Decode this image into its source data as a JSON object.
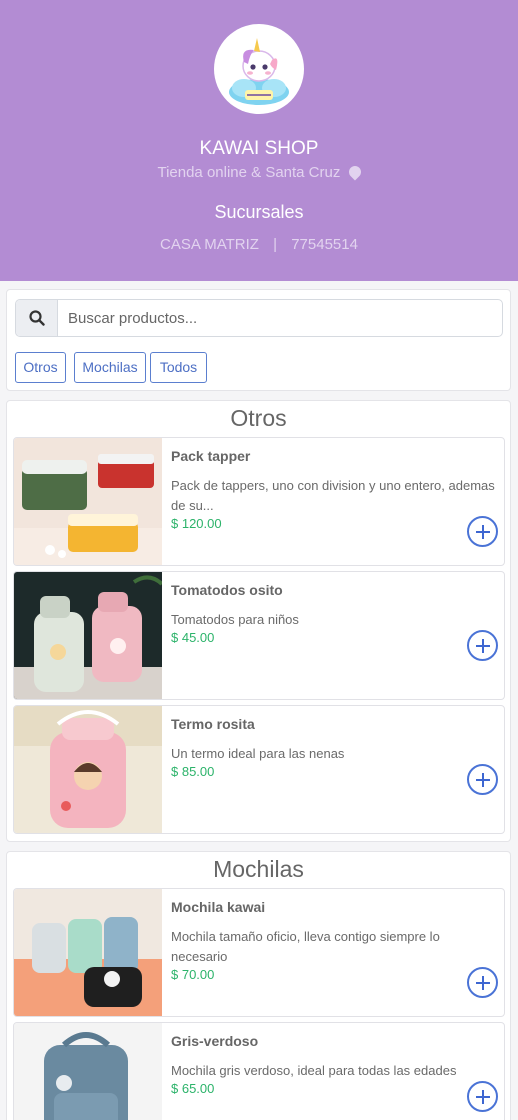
{
  "header": {
    "logo_icon": "unicorn-cloud-logo",
    "logo_text": "KAWAII SHOP",
    "shop_name": "KAWAI SHOP",
    "tagline": "Tienda online & Santa Cruz",
    "branches_title": "Sucursales",
    "branch_name": "CASA MATRIZ",
    "branch_separator": "|",
    "branch_phone": "77545514"
  },
  "search": {
    "icon": "search-icon",
    "placeholder": "Buscar productos..."
  },
  "filters": [
    "Otros",
    "Mochilas",
    "Todos"
  ],
  "sections": [
    {
      "title": "Otros",
      "products": [
        {
          "name": "Pack tapper",
          "description": "Pack de tappers, uno con division y uno entero, ademas de su...",
          "price": "$ 120.00"
        },
        {
          "name": "Tomatodos osito",
          "description": "Tomatodos para niños",
          "price": "$ 45.00"
        },
        {
          "name": "Termo rosita",
          "description": "Un termo ideal para las nenas",
          "price": "$ 85.00"
        }
      ]
    },
    {
      "title": "Mochilas",
      "products": [
        {
          "name": "Mochila kawai",
          "description": "Mochila tamaño oficio, lleva contigo siempre lo necesario",
          "price": "$ 70.00"
        },
        {
          "name": "Gris-verdoso",
          "description": "Mochila gris verdoso, ideal para todas las edades",
          "price": "$ 65.00"
        }
      ]
    }
  ],
  "colors": {
    "header_bg": "#b38cd3",
    "price": "#2cb36a",
    "accent_blue": "#4a73d6"
  }
}
